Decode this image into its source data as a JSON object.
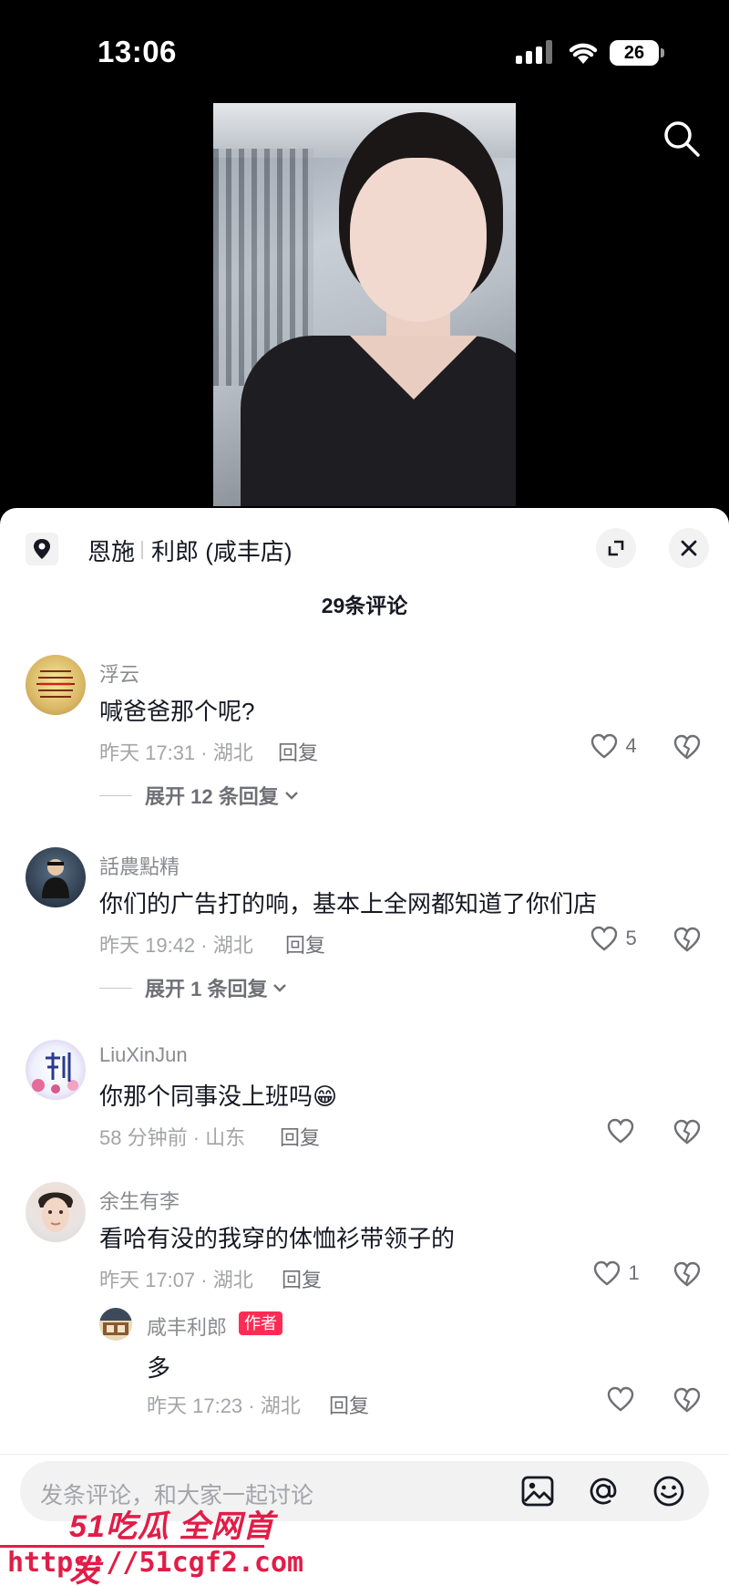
{
  "status_bar": {
    "time": "13:06",
    "battery": "26"
  },
  "location": {
    "city": "恩施",
    "store": "利郎 (咸丰店)"
  },
  "comment_count_label": "29条评论",
  "comments": [
    {
      "name": "浮云",
      "text": "喊爸爸那个呢?",
      "meta": "昨天 17:31 · 湖北",
      "reply_label": "回复",
      "likes": "4",
      "expand_label": "展开 12 条回复"
    },
    {
      "name": "話農點精",
      "text": "你们的广告打的响，基本上全网都知道了你们店",
      "meta": "昨天 19:42 · 湖北",
      "reply_label": "回复",
      "likes": "5",
      "expand_label": "展开 1 条回复"
    },
    {
      "name": "LiuXinJun",
      "text": "你那个同事没上班吗😁",
      "meta": "58 分钟前 · 山东",
      "reply_label": "回复",
      "likes": ""
    },
    {
      "name": "余生有李",
      "text": "看哈有没的我穿的体恤衫带领子的",
      "meta": "昨天 17:07 · 湖北",
      "reply_label": "回复",
      "likes": "1"
    }
  ],
  "author_reply": {
    "name": "咸丰利郎",
    "badge": "作者",
    "text": "多",
    "meta": "昨天 17:23 · 湖北",
    "reply_label": "回复",
    "likes": ""
  },
  "input": {
    "placeholder": "发条评论，和大家一起讨论"
  },
  "watermark": {
    "brand": "51吃瓜 全网首发",
    "url": "https://51cgf2.com"
  },
  "icons": [
    "search-icon",
    "location-pin-icon",
    "expand-icon",
    "close-icon",
    "heart-icon",
    "dislike-icon",
    "chevron-down-icon",
    "image-icon",
    "at-icon",
    "emoji-icon"
  ],
  "colors": {
    "accent": "#fe2c55",
    "text": "#161823",
    "muted": "#a3a4a9",
    "watermark": "#e11d48"
  }
}
